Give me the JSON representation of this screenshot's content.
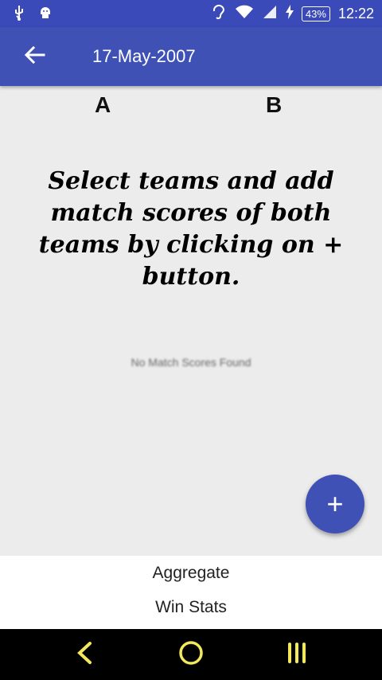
{
  "status_bar": {
    "battery": "43%",
    "time": "12:22"
  },
  "app_bar": {
    "title": "17-May-2007"
  },
  "columns": {
    "a": "A",
    "b": "B"
  },
  "instructions": "Select teams and add match scores of both teams by clicking on + button.",
  "empty_state": "No Match Scores Found",
  "fab": {
    "label": "+"
  },
  "bottom_panel": {
    "items": [
      {
        "label": "Aggregate"
      },
      {
        "label": "Win Stats"
      }
    ]
  },
  "colors": {
    "primary": "#3f51b5",
    "status_bar": "#3a4ab8",
    "nav_icons": "#f2e85a",
    "background": "#ececec"
  }
}
